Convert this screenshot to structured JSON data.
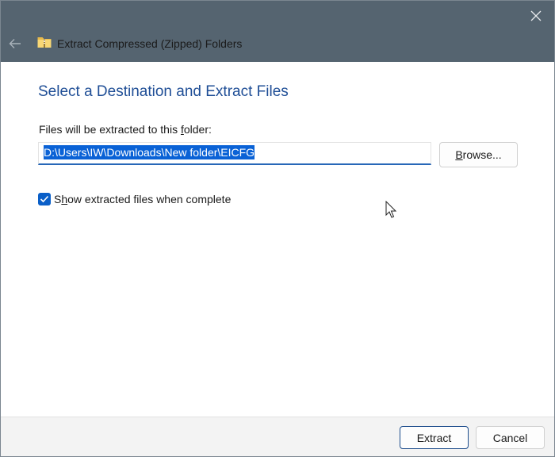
{
  "window": {
    "title": "Extract Compressed (Zipped) Folders",
    "icons": {
      "back": "back-arrow-icon",
      "close": "close-icon",
      "folder": "zip-folder-icon"
    }
  },
  "content": {
    "heading": "Select a Destination and Extract Files",
    "path_label": "Files will be extracted to this folder:",
    "path_value": "D:\\Users\\IW\\Downloads\\New folder\\EICFG",
    "browse_label": "Browse...",
    "show_files_label": "Show extracted files when complete",
    "show_files_checked": true
  },
  "footer": {
    "extract_label": "Extract",
    "cancel_label": "Cancel"
  },
  "colors": {
    "titlebar": "#556470",
    "heading": "#1f4e96",
    "accent": "#0a62d6"
  }
}
